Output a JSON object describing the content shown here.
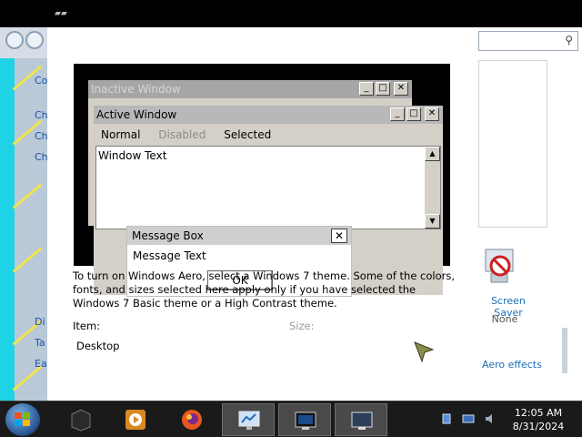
{
  "preview": {
    "inactive_title": "Inactive Window",
    "active_title": "Active Window",
    "menu": {
      "normal": "Normal",
      "disabled": "Disabled",
      "selected": "Selected"
    },
    "window_text": "Window Text",
    "message_box_title": "Message Box",
    "message_text": "Message Text",
    "ok_label": "OK",
    "minimize_glyph": "_",
    "maximize_glyph": "□",
    "close_glyph": "✕",
    "scroll_up_glyph": "▲",
    "scroll_down_glyph": "▼"
  },
  "info_text": "To turn on Windows Aero, select a Windows 7 theme.  Some of the colors, fonts, and sizes selected here apply only if you have selected the Windows 7 Basic theme or a High Contrast theme.",
  "item_label": "Item:",
  "size_label": "Size:",
  "item_value": "Desktop",
  "left_window": {
    "links": [
      "Co",
      "Ch",
      "Ch",
      "Ch",
      "Di",
      "Ta",
      "Ea"
    ]
  },
  "right_window": {
    "screen_saver_label": "Screen Saver",
    "screen_saver_value": "None",
    "aero_effects": "Aero effects",
    "search_icon": "search-icon"
  },
  "taskbar": {
    "time": "12:05 AM",
    "date": "8/31/2024",
    "items": [
      "cube-app",
      "media-player",
      "firefox",
      "display-settings",
      "monitor-app",
      "screen-saver-app"
    ]
  },
  "colors": {
    "desktop_bg": "#000000",
    "active_title": "#b8b8b8",
    "inactive_title": "#a6a6a6",
    "window_face": "#d4d0c8",
    "link": "#1b6fb5"
  }
}
